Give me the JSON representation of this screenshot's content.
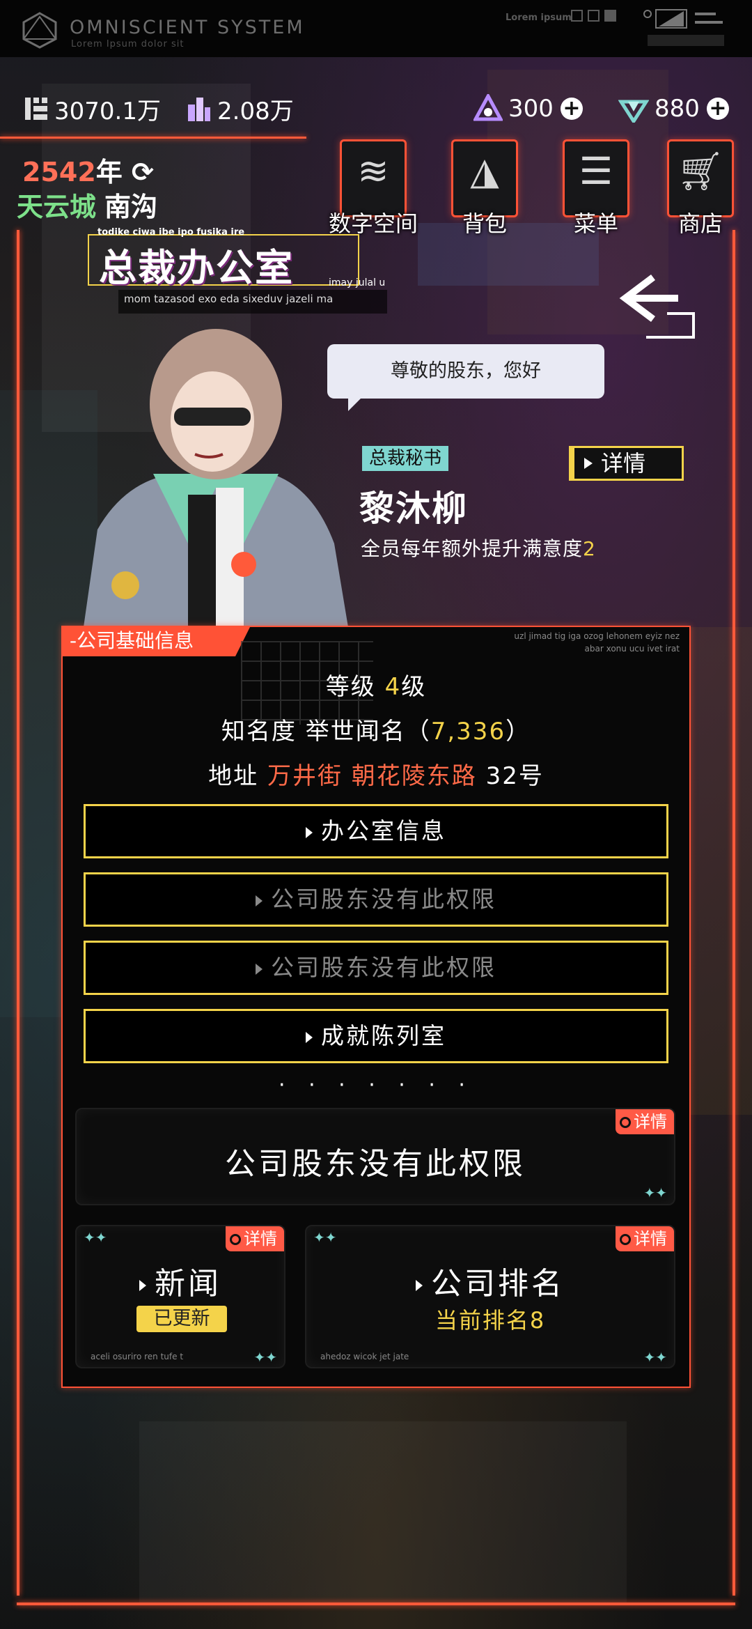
{
  "header": {
    "logo_title": "OMNISCIENT SYSTEM",
    "logo_subtitle": "Lorem Ipsum dolor sit",
    "corner_text": "Lorem ipsum"
  },
  "currencies": {
    "money": "3070.1万",
    "gems": "2.08万",
    "energy": "300",
    "diamond": "880"
  },
  "date": {
    "year_number": "2542",
    "year_unit": "年",
    "city": "天云城",
    "district": "南沟"
  },
  "nav": [
    {
      "label": "数字空间",
      "icon": "layers-icon"
    },
    {
      "label": "背包",
      "icon": "bag-icon"
    },
    {
      "label": "菜单",
      "icon": "menu-icon"
    },
    {
      "label": "商店",
      "icon": "cart-icon"
    }
  ],
  "location": {
    "title": "总裁办公室",
    "deco_top": "todike ciwa ibe ipo fusika ire",
    "deco_side": "imay julal u",
    "subtitle": "mom tazasod exo eda sixeduv jazeli ma"
  },
  "npc": {
    "greeting": "尊敬的股东，您好",
    "role": "总裁秘书",
    "name": "黎沐柳",
    "desc_prefix": "全员每年额外提升满意度",
    "desc_value": "2",
    "detail_label": "详情"
  },
  "company": {
    "tab_label": "-公司基础信息",
    "lorem_1": "uzl jimad tig iga ozog lehonem eyiz nez",
    "lorem_2": "abar xonu ucu ivet irat",
    "level_label": "等级",
    "level_value": "4",
    "level_unit": "级",
    "fame_label": "知名度",
    "fame_rank": "举世闻名",
    "fame_open": "（",
    "fame_value": "7,336",
    "fame_close": "）",
    "address_label": "地址",
    "address_street": "万井街 朝花陵东路",
    "address_number": "32号"
  },
  "menu": [
    {
      "label": "办公室信息",
      "enabled": true
    },
    {
      "label": "公司股东没有此权限",
      "enabled": false
    },
    {
      "label": "公司股东没有此权限",
      "enabled": false
    },
    {
      "label": "成就陈列室",
      "enabled": true
    }
  ],
  "dots": "· · · · · · ·",
  "cards": {
    "main": {
      "text": "公司股东没有此权限",
      "tag": "详情"
    },
    "news": {
      "title": "新闻",
      "badge": "已更新",
      "tag": "详情",
      "small": "aceli osuriro ren tufe t"
    },
    "ranking": {
      "title": "公司排名",
      "rank_prefix": "当前排名",
      "rank_value": "8",
      "tag": "详情",
      "small": "ahedoz wicok jet jate"
    }
  },
  "colors": {
    "accent_red": "#ff5236",
    "accent_yellow": "#f4d34a",
    "accent_teal": "#7fd6d0",
    "city_green": "#7de08a"
  }
}
